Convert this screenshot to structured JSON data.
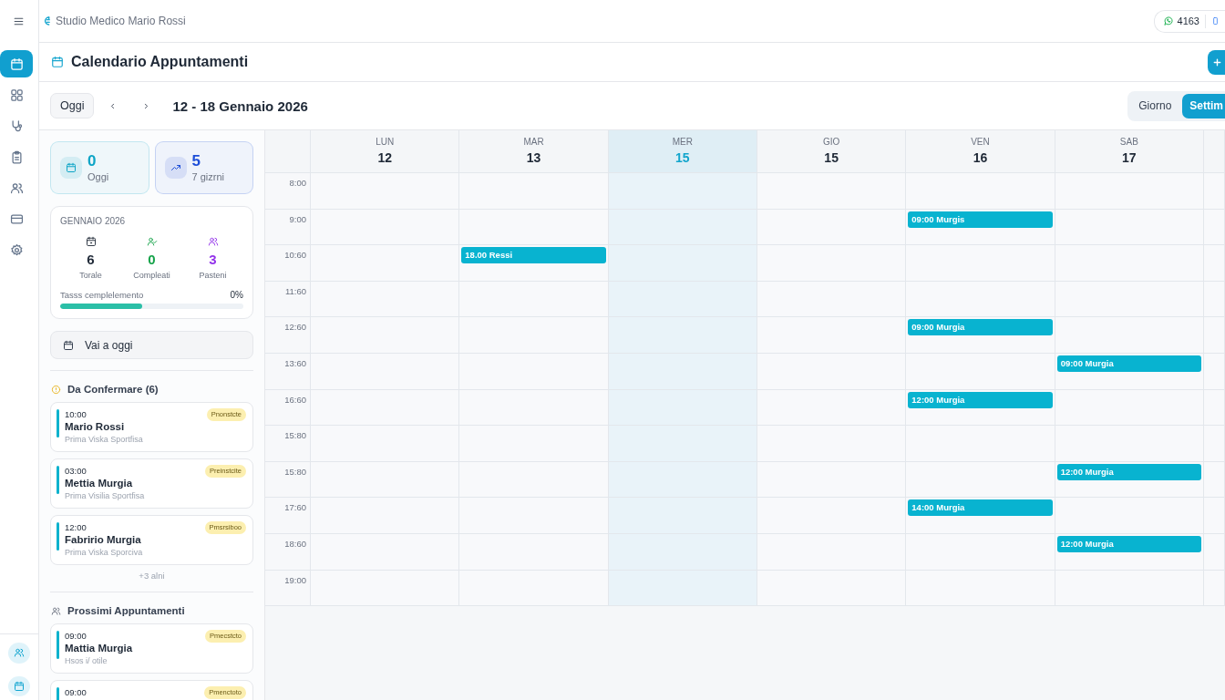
{
  "app_bar": {
    "title": "Studio Medico Mario Rossi",
    "counter": "4163"
  },
  "sidebar": {
    "items": [
      {
        "selected": true
      },
      {
        "selected": false
      },
      {
        "selected": false
      },
      {
        "selected": false
      },
      {
        "selected": false
      },
      {
        "selected": false
      },
      {
        "selected": false
      }
    ]
  },
  "header": {
    "title": "Calendario Appuntamenti"
  },
  "toolbar": {
    "today_button": "Oggi",
    "range": "12 - 18 Gennaio 2026",
    "views": [
      {
        "label": "Giorno",
        "selected": false
      },
      {
        "label": "Settim",
        "selected": true
      }
    ]
  },
  "summary_cards": [
    {
      "value": "0",
      "label": "Oggi",
      "color": "#0ea5c6"
    },
    {
      "value": "5",
      "label": "7 gizrni",
      "color": "#1d4ed8"
    }
  ],
  "month_card": {
    "title": "GENNAIO 2026",
    "stats": [
      {
        "value": "6",
        "label": "Torale",
        "color": "#1f2937"
      },
      {
        "value": "0",
        "label": "Compleati",
        "color": "#16a34a"
      },
      {
        "value": "3",
        "label": "Pasteni",
        "color": "#9333ea"
      }
    ],
    "progress": {
      "label": "Tasss cemplelemento",
      "reading": "0%",
      "level": 0.45
    }
  },
  "go_today_button": "Vai a oggi",
  "to_confirm": {
    "title": "Da Confermare (6)",
    "items": [
      {
        "time": "10:00",
        "name": "Mario Rossi",
        "service": "Prima Viska Sportfisa",
        "badge": "Pnonstcte"
      },
      {
        "time": "03:00",
        "name": "Mettia Murgia",
        "service": "Prima Visilia Sportfisa",
        "badge": "Preinstcite"
      },
      {
        "time": "12:00",
        "name": "Fabririo Murgia",
        "service": "Prima Viska Sporciva",
        "badge": "Pmsrsiboo"
      }
    ],
    "more": "+3 alni"
  },
  "upcoming": {
    "title": "Prossimi Appuntamenti",
    "items": [
      {
        "time": "09:00",
        "name": "Mattia Murgia",
        "service": "Hsos i/ otile",
        "badge": "Pmecstcto"
      },
      {
        "time": "09:00",
        "badge": "Pmenctoto"
      }
    ]
  },
  "calendar": {
    "days": [
      {
        "weekday": "LUN",
        "date": "12",
        "selected": false
      },
      {
        "weekday": "MAR",
        "date": "13",
        "selected": false
      },
      {
        "weekday": "MER",
        "date": "15",
        "selected": true
      },
      {
        "weekday": "GIO",
        "date": "15",
        "selected": false
      },
      {
        "weekday": "VEN",
        "date": "16",
        "selected": false
      },
      {
        "weekday": "SAB",
        "date": "17",
        "selected": false
      }
    ],
    "rows": [
      {
        "time": "8:00",
        "cells": [
          {
            "kind": "empty"
          },
          {
            "kind": "empty"
          },
          {
            "kind": "empty"
          },
          {
            "kind": "empty"
          },
          {
            "kind": "empty"
          },
          {
            "kind": "empty"
          }
        ]
      },
      {
        "time": "9:00",
        "cells": [
          {
            "kind": "empty"
          },
          {
            "kind": "empty"
          },
          {
            "kind": "empty"
          },
          {
            "kind": "empty"
          },
          {
            "kind": "event",
            "label": "09:00 Murgis"
          },
          {
            "kind": "empty"
          }
        ]
      },
      {
        "time": "10:60",
        "cells": [
          {
            "kind": "empty"
          },
          {
            "kind": "event",
            "label": "18.00 Ressi"
          },
          {
            "kind": "empty"
          },
          {
            "kind": "empty"
          },
          {
            "kind": "empty"
          },
          {
            "kind": "empty"
          }
        ]
      },
      {
        "time": "11:60",
        "cells": [
          {
            "kind": "empty"
          },
          {
            "kind": "empty"
          },
          {
            "kind": "empty"
          },
          {
            "kind": "empty"
          },
          {
            "kind": "empty"
          },
          {
            "kind": "empty"
          }
        ]
      },
      {
        "time": "12:60",
        "cells": [
          {
            "kind": "empty"
          },
          {
            "kind": "empty"
          },
          {
            "kind": "empty"
          },
          {
            "kind": "empty"
          },
          {
            "kind": "event",
            "label": "09:00 Murgia"
          },
          {
            "kind": "empty"
          }
        ]
      },
      {
        "time": "13:60",
        "cells": [
          {
            "kind": "empty"
          },
          {
            "kind": "empty"
          },
          {
            "kind": "empty"
          },
          {
            "kind": "empty"
          },
          {
            "kind": "empty"
          },
          {
            "kind": "event",
            "label": "09:00 Murgia"
          }
        ]
      },
      {
        "time": "16:60",
        "cells": [
          {
            "kind": "empty"
          },
          {
            "kind": "empty"
          },
          {
            "kind": "empty"
          },
          {
            "kind": "empty"
          },
          {
            "kind": "event",
            "label": "12:00 Murgia"
          },
          {
            "kind": "empty"
          }
        ]
      },
      {
        "time": "15:80",
        "cells": [
          {
            "kind": "empty"
          },
          {
            "kind": "empty"
          },
          {
            "kind": "empty"
          },
          {
            "kind": "empty"
          },
          {
            "kind": "empty"
          },
          {
            "kind": "empty"
          }
        ]
      },
      {
        "time": "15:80",
        "cells": [
          {
            "kind": "empty"
          },
          {
            "kind": "empty"
          },
          {
            "kind": "empty"
          },
          {
            "kind": "empty"
          },
          {
            "kind": "empty"
          },
          {
            "kind": "event",
            "label": "12:00 Murgia"
          }
        ]
      },
      {
        "time": "17:60",
        "cells": [
          {
            "kind": "empty"
          },
          {
            "kind": "empty"
          },
          {
            "kind": "empty"
          },
          {
            "kind": "empty"
          },
          {
            "kind": "event",
            "label": "14:00 Murgia"
          },
          {
            "kind": "empty"
          }
        ]
      },
      {
        "time": "18:60",
        "cells": [
          {
            "kind": "empty"
          },
          {
            "kind": "empty"
          },
          {
            "kind": "empty"
          },
          {
            "kind": "empty"
          },
          {
            "kind": "empty"
          },
          {
            "kind": "event",
            "label": "12:00 Murgia"
          }
        ]
      },
      {
        "time": "19:00",
        "cells": [
          {
            "kind": "empty"
          },
          {
            "kind": "empty"
          },
          {
            "kind": "empty"
          },
          {
            "kind": "empty"
          },
          {
            "kind": "empty"
          },
          {
            "kind": "empty"
          }
        ]
      }
    ]
  }
}
